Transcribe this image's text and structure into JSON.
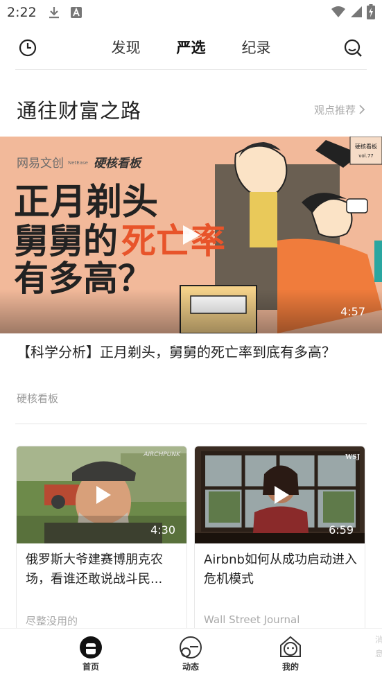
{
  "status_bar": {
    "time": "2:22"
  },
  "top_nav": {
    "tabs": [
      {
        "label": "发现"
      },
      {
        "label": "严选"
      },
      {
        "label": "纪录"
      }
    ],
    "active_tab": "严选"
  },
  "section": {
    "title": "通往财富之路",
    "more_label": "观点推荐"
  },
  "hero": {
    "overlay": {
      "brand": "网易文创",
      "brand_small": "NetEase",
      "channel": "硬核看板",
      "headline_line1": "正月剃头",
      "headline_line2_a": "舅舅的",
      "headline_line2_b": "死亡率",
      "headline_line3": "有多高？",
      "tag": "硬核看板",
      "tag_vol": "vol.77"
    },
    "duration": "4:57",
    "title": "【科学分析】正月剃头，舅舅的死亡率到底有多高？",
    "source": "硬核看板"
  },
  "cards": [
    {
      "duration": "4:30",
      "title": "俄罗斯大爷建赛博朋克农场，看谁还敢说战斗民...",
      "source": "尽整没用的",
      "watermark": "AIRCHPUNK"
    },
    {
      "duration": "6:59",
      "title": "Airbnb如何从成功启动进入危机模式",
      "source": "Wall Street Journal",
      "watermark": "WSJ"
    }
  ],
  "bottom_nav": {
    "items": [
      {
        "label": "首页",
        "icon": "home-icon"
      },
      {
        "label": "动态",
        "icon": "feed-icon"
      },
      {
        "label": "我的",
        "icon": "profile-icon"
      }
    ],
    "partial_label": "消息"
  },
  "colors": {
    "accent": "#e8542a",
    "hero_bg": "#f2b99a",
    "orange": "#f07c3c"
  }
}
